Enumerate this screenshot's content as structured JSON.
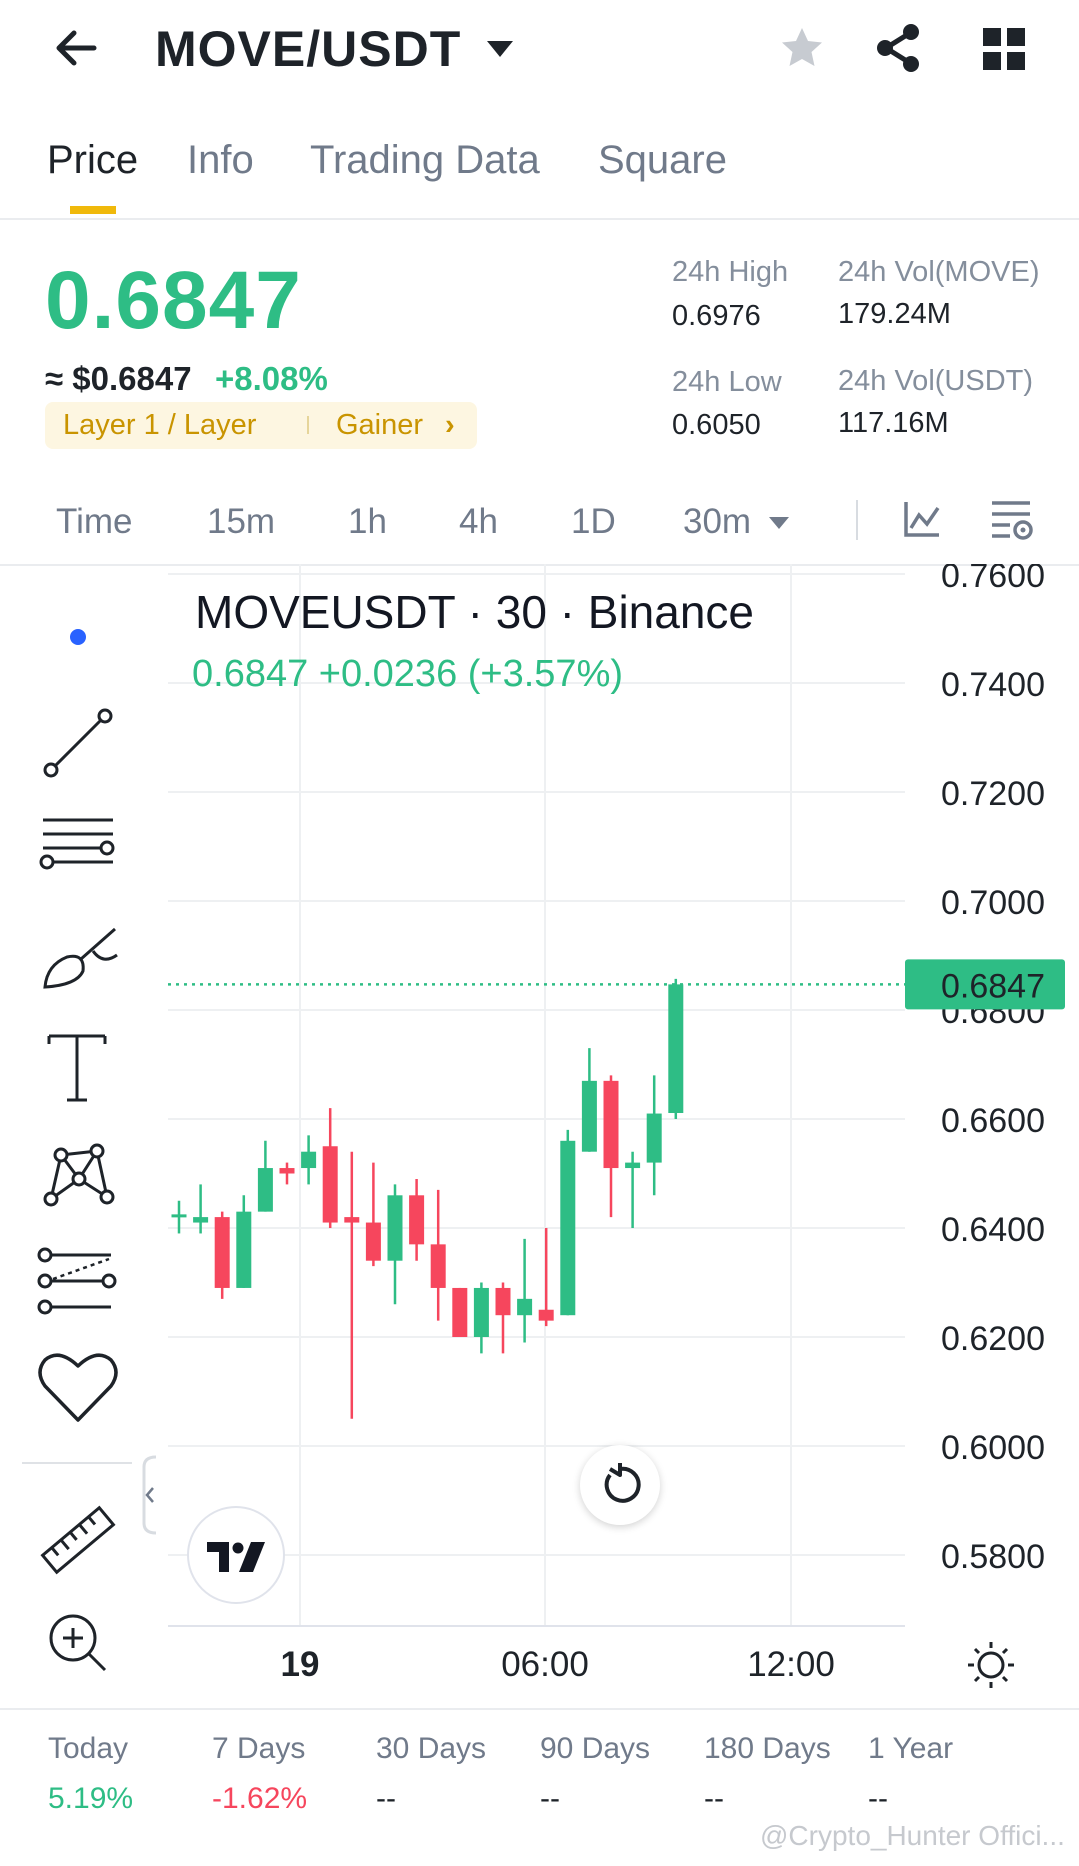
{
  "header": {
    "pair": "MOVE/USDT",
    "icons": [
      "back-arrow-icon",
      "caret-down-icon",
      "star-icon",
      "share-icon",
      "grid-icon"
    ]
  },
  "tabs": [
    {
      "label": "Price",
      "active": true
    },
    {
      "label": "Info",
      "active": false
    },
    {
      "label": "Trading Data",
      "active": false
    },
    {
      "label": "Square",
      "active": false
    }
  ],
  "price": {
    "last": "0.6847",
    "usd": "≈ $0.6847",
    "change_pct": "+8.08%",
    "tag1": "Layer 1 / Layer",
    "tag2": "Gainer",
    "tag_arrow": "›"
  },
  "stats": {
    "high_label": "24h High",
    "high_value": "0.6976",
    "vol_base_label": "24h Vol(MOVE)",
    "vol_base_value": "179.24M",
    "low_label": "24h Low",
    "low_value": "0.6050",
    "vol_quote_label": "24h Vol(USDT)",
    "vol_quote_value": "117.16M"
  },
  "intervals": [
    {
      "label": "Time",
      "active": false
    },
    {
      "label": "15m",
      "active": false
    },
    {
      "label": "1h",
      "active": false
    },
    {
      "label": "4h",
      "active": false
    },
    {
      "label": "1D",
      "active": false
    },
    {
      "label": "30m",
      "active": true
    }
  ],
  "chart_overlay": {
    "title": "MOVEUSDT · 30 · Binance",
    "ohlc_text": "0.6847  +0.0236 (+3.57%)",
    "current_price_label": "0.6847",
    "logo_text": "TV"
  },
  "colors": {
    "up": "#2ebd85",
    "down": "#f6465d",
    "accent": "#f0b90b",
    "grid": "#eef0f2"
  },
  "chart_data": {
    "type": "candlestick",
    "title": "MOVEUSDT · 30 · Binance",
    "y_ticks": [
      "0.7600",
      "0.7400",
      "0.7200",
      "0.7000",
      "0.6800",
      "0.6600",
      "0.6400",
      "0.6200",
      "0.6000",
      "0.5800"
    ],
    "x_ticks": [
      "19",
      "06:00",
      "12:00"
    ],
    "ylim": [
      0.568,
      0.762
    ],
    "current_price": 0.6847,
    "candles": [
      {
        "o": 0.642,
        "h": 0.645,
        "l": 0.639,
        "c": 0.6425
      },
      {
        "o": 0.641,
        "h": 0.648,
        "l": 0.639,
        "c": 0.642
      },
      {
        "o": 0.642,
        "h": 0.643,
        "l": 0.627,
        "c": 0.629
      },
      {
        "o": 0.629,
        "h": 0.646,
        "l": 0.629,
        "c": 0.643
      },
      {
        "o": 0.643,
        "h": 0.656,
        "l": 0.643,
        "c": 0.651
      },
      {
        "o": 0.651,
        "h": 0.652,
        "l": 0.648,
        "c": 0.65
      },
      {
        "o": 0.651,
        "h": 0.657,
        "l": 0.648,
        "c": 0.654
      },
      {
        "o": 0.655,
        "h": 0.662,
        "l": 0.64,
        "c": 0.641
      },
      {
        "o": 0.642,
        "h": 0.654,
        "l": 0.605,
        "c": 0.641
      },
      {
        "o": 0.641,
        "h": 0.652,
        "l": 0.633,
        "c": 0.634
      },
      {
        "o": 0.634,
        "h": 0.648,
        "l": 0.626,
        "c": 0.646
      },
      {
        "o": 0.646,
        "h": 0.649,
        "l": 0.634,
        "c": 0.637
      },
      {
        "o": 0.637,
        "h": 0.647,
        "l": 0.623,
        "c": 0.629
      },
      {
        "o": 0.629,
        "h": 0.627,
        "l": 0.621,
        "c": 0.62
      },
      {
        "o": 0.62,
        "h": 0.63,
        "l": 0.617,
        "c": 0.629
      },
      {
        "o": 0.629,
        "h": 0.63,
        "l": 0.617,
        "c": 0.624
      },
      {
        "o": 0.624,
        "h": 0.638,
        "l": 0.619,
        "c": 0.627
      },
      {
        "o": 0.625,
        "h": 0.64,
        "l": 0.622,
        "c": 0.623
      },
      {
        "o": 0.624,
        "h": 0.658,
        "l": 0.624,
        "c": 0.656
      },
      {
        "o": 0.654,
        "h": 0.673,
        "l": 0.654,
        "c": 0.667
      },
      {
        "o": 0.667,
        "h": 0.668,
        "l": 0.642,
        "c": 0.651
      },
      {
        "o": 0.651,
        "h": 0.654,
        "l": 0.64,
        "c": 0.652
      },
      {
        "o": 0.652,
        "h": 0.668,
        "l": 0.646,
        "c": 0.661
      },
      {
        "o": 0.6611,
        "h": 0.6857,
        "l": 0.66,
        "c": 0.6847
      }
    ]
  },
  "performance": [
    {
      "label": "Today",
      "value": "5.19%",
      "tone": "up"
    },
    {
      "label": "7 Days",
      "value": "-1.62%",
      "tone": "down"
    },
    {
      "label": "30 Days",
      "value": "--",
      "tone": "neutral"
    },
    {
      "label": "90 Days",
      "value": "--",
      "tone": "neutral"
    },
    {
      "label": "180 Days",
      "value": "--",
      "tone": "neutral"
    },
    {
      "label": "1 Year",
      "value": "--",
      "tone": "neutral"
    }
  ],
  "watermark": "@Crypto_Hunter Offici..."
}
